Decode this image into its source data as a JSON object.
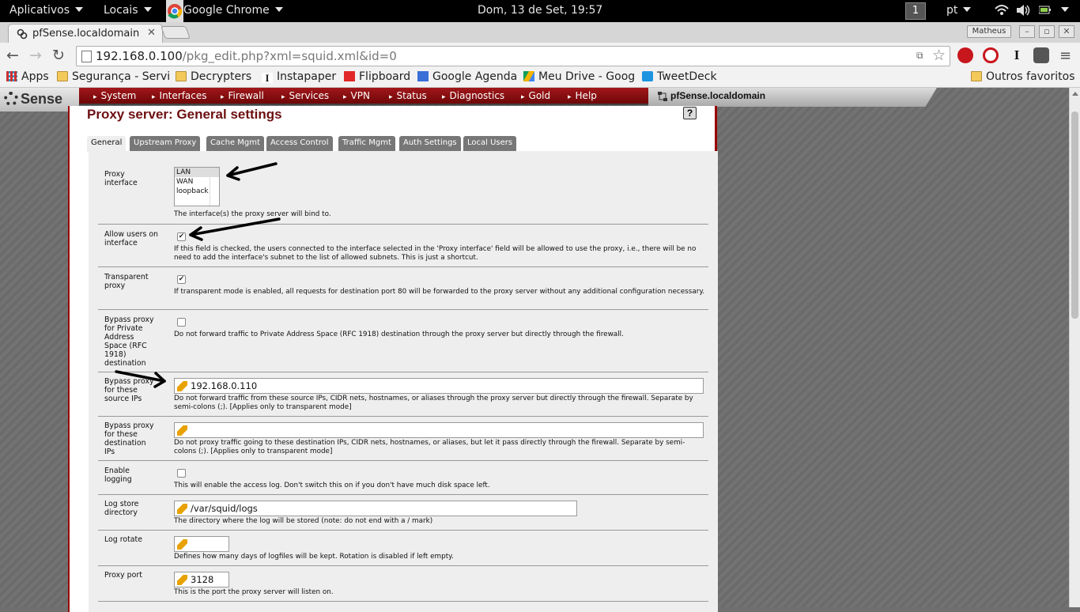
{
  "gnome": {
    "apps_menu": "Aplicativos",
    "places_menu": "Locais",
    "app_name": "Google Chrome",
    "clock": "Dom, 13 de Set, 19:57",
    "workspace": "1",
    "keyboard_layout": "pt"
  },
  "browser": {
    "tab_title": "pfSense.localdomain",
    "user_badge": "Matheus",
    "url_host": "192.168.0.100",
    "url_path": "/pkg_edit.php?xml=squid.xml&id=0",
    "bookmarks": [
      {
        "label": "Apps",
        "icon": "apps-grid-icon"
      },
      {
        "label": "Segurança - Servi",
        "icon": "folder-icon"
      },
      {
        "label": "Decrypters",
        "icon": "folder-icon"
      },
      {
        "label": "Instapaper",
        "icon": "instapaper-icon"
      },
      {
        "label": "Flipboard",
        "icon": "flipboard-icon"
      },
      {
        "label": "Google Agenda",
        "icon": "calendar-icon"
      },
      {
        "label": "Meu Drive - Goog",
        "icon": "drive-icon"
      },
      {
        "label": "TweetDeck",
        "icon": "tweetdeck-icon"
      }
    ],
    "other_bookmarks": "Outros favoritos"
  },
  "pfsense": {
    "logo": "Sense",
    "menu": [
      "System",
      "Interfaces",
      "Firewall",
      "Services",
      "VPN",
      "Status",
      "Diagnostics",
      "Gold",
      "Help"
    ],
    "hostname": "pfSense.localdomain",
    "page_title": "Proxy server: General settings",
    "help_label": "?",
    "tabs": [
      "General",
      "Upstream Proxy",
      "Cache Mgmt",
      "Access Control",
      "Traffic Mgmt",
      "Auth Settings",
      "Local Users"
    ],
    "active_tab": "General",
    "fields": {
      "proxy_interface": {
        "label": "Proxy interface",
        "options": [
          "LAN",
          "WAN",
          "loopback"
        ],
        "selected": "LAN",
        "desc": "The interface(s) the proxy server will bind to."
      },
      "allow_users": {
        "label": "Allow users on interface",
        "checked": true,
        "desc": "If this field is checked, the users connected to the interface selected in the 'Proxy interface' field will be allowed to use the proxy, i.e., there will be no need to add the interface's subnet to the list of allowed subnets. This is just a shortcut."
      },
      "transparent": {
        "label": "Transparent proxy",
        "checked": true,
        "desc": "If transparent mode is enabled, all requests for destination port 80 will be forwarded to the proxy server without any additional configuration necessary."
      },
      "bypass_private": {
        "label": "Bypass proxy for Private Address Space (RFC 1918) destination",
        "checked": false,
        "desc": "Do not forward traffic to Private Address Space (RFC 1918) destination through the proxy server but directly through the firewall."
      },
      "bypass_source": {
        "label": "Bypass proxy for these source IPs",
        "value": "192.168.0.110",
        "desc": "Do not forward traffic from these source IPs, CIDR nets, hostnames, or aliases through the proxy server but directly through the firewall. Separate by semi-colons (;). [Applies only to transparent mode]"
      },
      "bypass_dest": {
        "label": "Bypass proxy for these destination IPs",
        "value": "",
        "desc": "Do not proxy traffic going to these destination IPs, CIDR nets, hostnames, or aliases, but let it pass directly through the firewall. Separate by semi-colons (;). [Applies only to transparent mode]"
      },
      "logging": {
        "label": "Enable logging",
        "checked": false,
        "desc": "This will enable the access log. Don't switch this on if you don't have much disk space left."
      },
      "log_dir": {
        "label": "Log store directory",
        "value": "/var/squid/logs",
        "desc": "The directory where the log will be stored (note: do not end with a / mark)"
      },
      "log_rotate": {
        "label": "Log rotate",
        "value": "",
        "desc": "Defines how many days of logfiles will be kept. Rotation is disabled if left empty."
      },
      "proxy_port": {
        "label": "Proxy port",
        "value": "3128",
        "desc": "This is the port the proxy server will listen on."
      }
    }
  }
}
